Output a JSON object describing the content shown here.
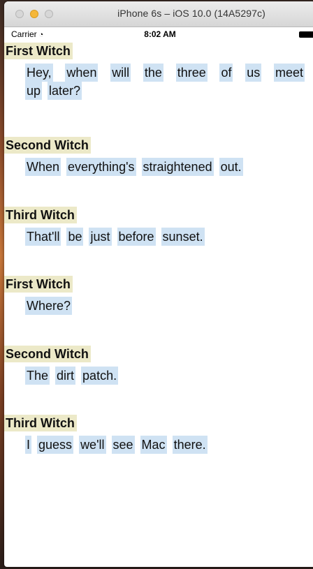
{
  "window": {
    "title": "iPhone 6s – iOS 10.0 (14A5297c)"
  },
  "status": {
    "carrier": "Carrier",
    "time": "8:02 AM"
  },
  "dialogue": [
    {
      "speaker": "First Witch",
      "words": [
        "Hey,",
        "when",
        "will",
        "the",
        "three",
        "of",
        "us",
        "meet"
      ],
      "words2": [
        "up",
        "later?"
      ]
    },
    {
      "speaker": "Second Witch",
      "words": [
        "When",
        "everything's",
        "straightened",
        "out."
      ]
    },
    {
      "speaker": "Third Witch",
      "words": [
        "That'll",
        "be",
        "just",
        "before",
        "sunset."
      ]
    },
    {
      "speaker": "First Witch",
      "words": [
        "Where?"
      ]
    },
    {
      "speaker": "Second Witch",
      "words": [
        "The",
        "dirt",
        "patch."
      ]
    },
    {
      "speaker": "Third Witch",
      "words": [
        "I",
        "guess",
        "we'll",
        "see",
        "Mac",
        "there."
      ]
    }
  ]
}
